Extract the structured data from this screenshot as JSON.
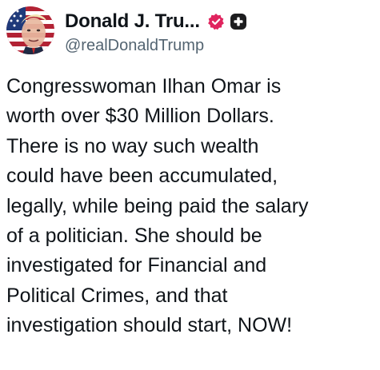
{
  "post": {
    "author": {
      "display_name": "Donald J. Tru...",
      "handle": "@realDonaldTrump",
      "verified_badge_icon": "verified-check-icon",
      "extra_badge_icon": "plus-badge-icon",
      "verified_color": "#e0245e",
      "extra_badge_color": "#1d1d1f"
    },
    "body_lines": [
      "Congresswoman Ilhan Omar is",
      "worth over $30 Million Dollars.",
      "There is no way such wealth",
      "could have been accumulated,",
      "legally, while being paid the salary",
      "of a politician. She should be",
      "investigated for Financial and",
      "Political Crimes, and that",
      "investigation should start, NOW!"
    ]
  }
}
